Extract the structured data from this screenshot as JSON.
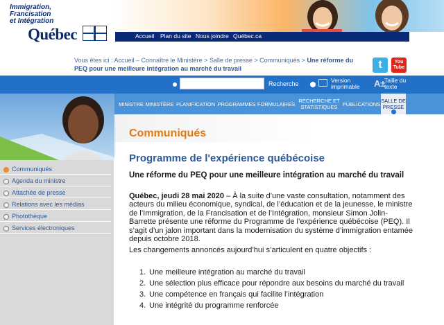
{
  "header": {
    "ministry_lines": [
      "Immigration,",
      "Francisation",
      "et Intégration"
    ],
    "brand": "Québec",
    "nav": [
      "Accueil",
      "Plan du site",
      "Nous joindre",
      "Québec.ca"
    ]
  },
  "breadcrumb": {
    "prefix": "Vous êtes ici : Accueil – Connaître le Ministère > Salle de presse > Communiqués > ",
    "current": "Une réforme du PEQ pour une meilleure intégration au marché du travail"
  },
  "social": {
    "twitter": "t",
    "youtube": "You Tube"
  },
  "toolbar": {
    "search_placeholder": "",
    "search_label": "Recherche",
    "print_label": "Version imprimable",
    "text_size_label": "Taille du texte",
    "text_size_icon": "A±"
  },
  "main_menu": [
    "MINISTRE",
    "MINISTÈRE",
    "PLANIFICATION",
    "PROGRAMMES",
    "FORMULAIRES",
    "RECHERCHE ET STATISTIQUES",
    "PUBLICATIONS",
    "SALLE DE PRESSE"
  ],
  "sidebar": {
    "items": [
      "Communiqués",
      "Agenda du ministre",
      "Attachée de presse",
      "Relations avec les médias",
      "Photothèque",
      "Services électroniques"
    ]
  },
  "content": {
    "section_title": "Communiqués",
    "program_title": "Programme de l'expérience québécoise",
    "subtitle": "Une réforme du PEQ pour une meilleure intégration au marché du travail",
    "dateline": "Québec, jeudi 28 mai 2020",
    "para1": " – À la suite d’une vaste consultation, notamment des acteurs du milieu économique, syndical, de l’éducation et de la jeunesse, le ministre de l’Immigration, de la Francisation et de l’Intégration, monsieur Simon Jolin-Barrette présente une réforme du Programme de l’expérience québécoise (PEQ). Il s’agit d’un jalon important dans la modernisation du système d’immigration entamée depuis octobre 2018.",
    "para2": "Les changements annoncés aujourd’hui s’articulent en quatre objectifs :",
    "objectives": [
      "Une meilleure intégration au marché du travail",
      "Une sélection plus efficace pour répondre aux besoins du marché du travail",
      "Une compétence en français qui facilite l’intégration",
      "Une intégrité du programme renforcée"
    ]
  },
  "colors": {
    "navy": "#0b2b6b",
    "blue_bar": "#2370c8",
    "menu_blue": "#4a93d8",
    "orange_heading": "#e07a14",
    "link_blue": "#2d5a96"
  }
}
